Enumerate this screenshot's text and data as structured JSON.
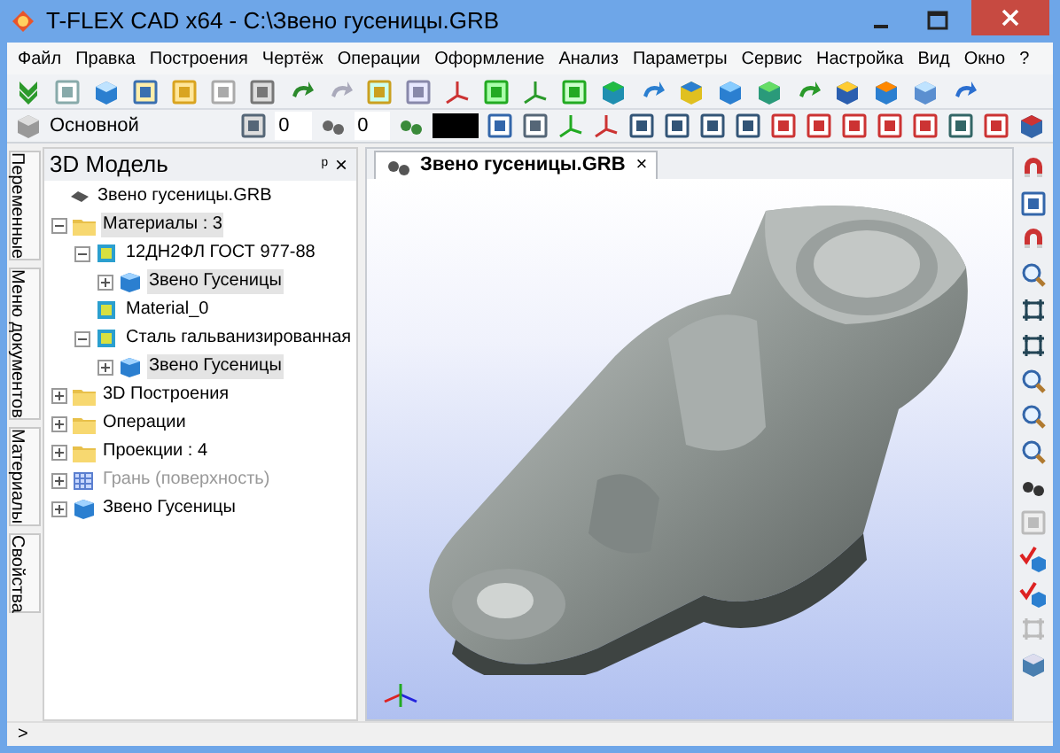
{
  "window": {
    "title": "T-FLEX CAD x64 - C:\\Звено гусеницы.GRB"
  },
  "menu": [
    "Файл",
    "Правка",
    "Построения",
    "Чертёж",
    "Операции",
    "Оформление",
    "Анализ",
    "Параметры",
    "Сервис",
    "Настройка",
    "Вид",
    "Окно",
    "?"
  ],
  "toolbar2": {
    "style": "Основной",
    "layer": "0",
    "level": "0"
  },
  "side_tabs": [
    "Переменные",
    "Меню документов",
    "Материалы",
    "Свойства"
  ],
  "panel": {
    "title": "3D Модель",
    "pin": "ᵖ",
    "close": "×",
    "tree": [
      {
        "label": "Звено гусеницы.GRB",
        "kind": "root",
        "children": [
          {
            "label": "Материалы : 3",
            "kind": "folder",
            "expanded": true,
            "highlighted": true,
            "children": [
              {
                "label": "12ДН2ФЛ ГОСТ 977-88",
                "kind": "material",
                "expanded": true,
                "children": [
                  {
                    "label": "Звено Гусеницы",
                    "kind": "body",
                    "expanded": false,
                    "highlighted": true
                  }
                ]
              },
              {
                "label": "Material_0",
                "kind": "material"
              },
              {
                "label": "Сталь гальванизированная",
                "kind": "material",
                "expanded": true,
                "children": [
                  {
                    "label": "Звено Гусеницы",
                    "kind": "body",
                    "expanded": false,
                    "highlighted": true
                  }
                ]
              }
            ]
          },
          {
            "label": "3D Построения",
            "kind": "folder",
            "expanded": false
          },
          {
            "label": "Операции",
            "kind": "folder",
            "expanded": false
          },
          {
            "label": "Проекции : 4",
            "kind": "folder",
            "expanded": false
          },
          {
            "label": "Грань (поверхность)",
            "kind": "face",
            "expanded": false,
            "disabled": true
          },
          {
            "label": "Звено Гусеницы",
            "kind": "body",
            "expanded": false
          }
        ]
      }
    ]
  },
  "document_tab": {
    "label": "Звено гусеницы.GRB",
    "close": "×"
  },
  "status_bar": {
    "text": ">"
  }
}
